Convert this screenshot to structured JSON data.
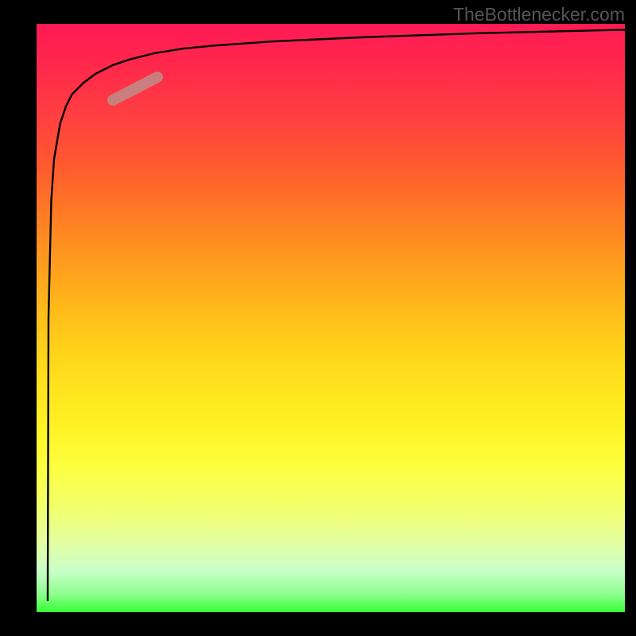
{
  "attribution": "TheBottlenecker.com",
  "chart_data": {
    "type": "line",
    "title": "",
    "xlabel": "",
    "ylabel": "",
    "xlim": [
      0,
      1
    ],
    "ylim": [
      0,
      1
    ],
    "series": [
      {
        "name": "curve",
        "x": [
          0.019,
          0.02,
          0.025,
          0.03,
          0.04,
          0.05,
          0.06,
          0.08,
          0.1,
          0.13,
          0.16,
          0.2,
          0.25,
          0.3,
          0.4,
          0.55,
          0.75,
          1.0
        ],
        "y": [
          0.02,
          0.5,
          0.7,
          0.77,
          0.83,
          0.86,
          0.88,
          0.9,
          0.915,
          0.93,
          0.94,
          0.95,
          0.958,
          0.963,
          0.97,
          0.977,
          0.984,
          0.99
        ]
      }
    ],
    "highlight": {
      "x_start": 0.13,
      "x_end": 0.205,
      "y_start": 0.87,
      "y_end": 0.91
    },
    "background_gradient": {
      "top_color": "#ff1a55",
      "bottom_color": "#35ff35",
      "description": "vertical spectral gradient red → orange → yellow → green"
    }
  }
}
